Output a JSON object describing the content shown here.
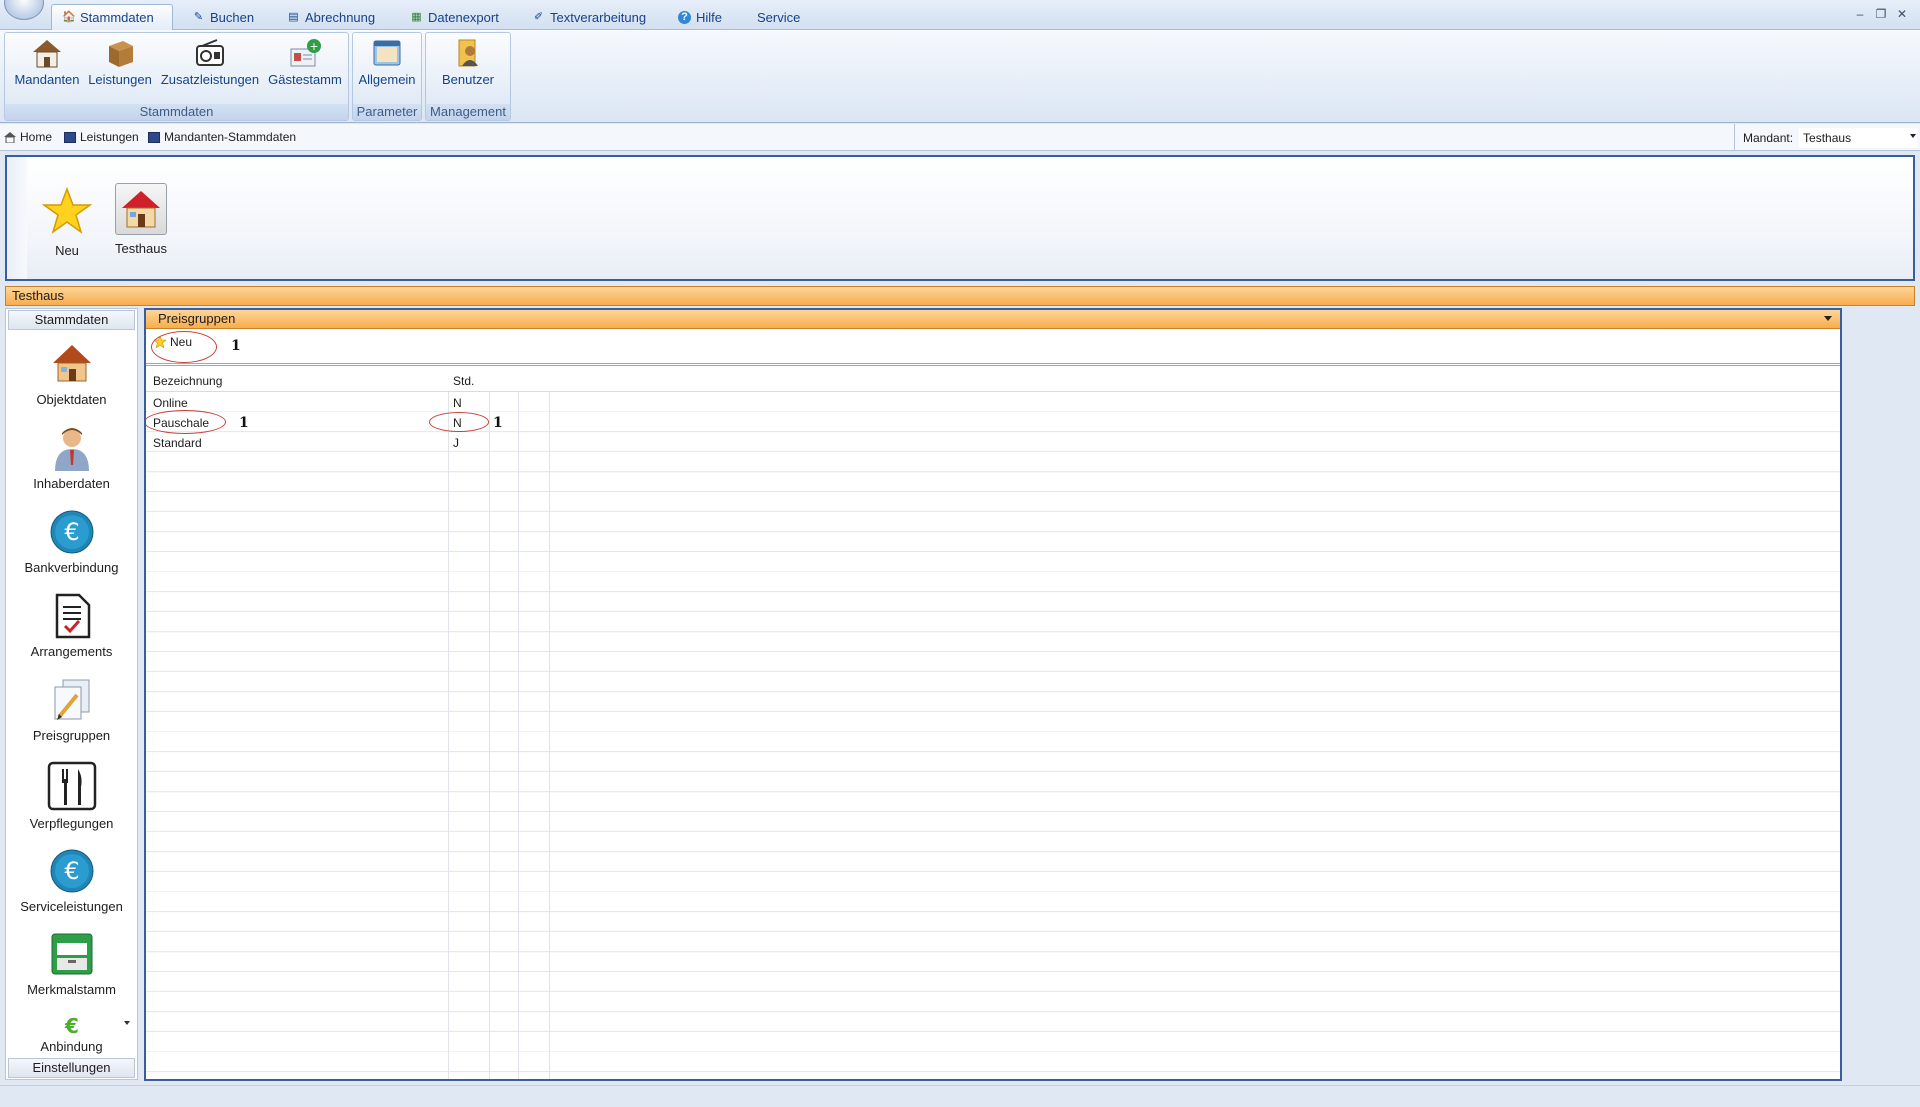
{
  "menu": {
    "tabs": [
      {
        "label": "Stammdaten",
        "icon": "stammdaten-icon",
        "active": true
      },
      {
        "label": "Buchen",
        "icon": "buchen-icon"
      },
      {
        "label": "Abrechnung",
        "icon": "abrechnung-icon"
      },
      {
        "label": "Datenexport",
        "icon": "datenexport-icon"
      },
      {
        "label": "Textverarbeitung",
        "icon": "textverarbeitung-icon"
      },
      {
        "label": "Hilfe",
        "icon": "help-icon"
      },
      {
        "label": "Service",
        "icon": ""
      }
    ],
    "window_controls": {
      "minimize": "–",
      "restore": "❐",
      "close": "✕"
    }
  },
  "ribbon": {
    "groups": [
      {
        "label": "Stammdaten",
        "buttons": [
          "Mandanten",
          "Leistungen",
          "Zusatzleistungen",
          "Gästestamm"
        ]
      },
      {
        "label": "Parameter",
        "buttons": [
          "Allgemein"
        ]
      },
      {
        "label": "Management",
        "buttons": [
          "Benutzer"
        ]
      }
    ]
  },
  "breadcrumb": {
    "items": [
      "Home",
      "Leistungen",
      "Mandanten-Stammdaten"
    ],
    "mandant_label": "Mandant:",
    "mandant_value": "Testhaus"
  },
  "toppanel": {
    "buttons": [
      {
        "label": "Neu",
        "icon": "star-icon"
      },
      {
        "label": "Testhaus",
        "icon": "house-icon"
      }
    ]
  },
  "house_bar": {
    "title": "Testhaus"
  },
  "sidenav": {
    "header_top": "Stammdaten",
    "items": [
      {
        "label": "Objektdaten",
        "icon": "house-icon"
      },
      {
        "label": "Inhaberdaten",
        "icon": "person-icon"
      },
      {
        "label": "Bankverbindung",
        "icon": "euro-icon"
      },
      {
        "label": "Arrangements",
        "icon": "document-check-icon"
      },
      {
        "label": "Preisgruppen",
        "icon": "documents-pencil-icon"
      },
      {
        "label": "Verpflegungen",
        "icon": "fork-knife-icon"
      },
      {
        "label": "Serviceleistungen",
        "icon": "euro-icon"
      },
      {
        "label": "Merkmalstamm",
        "icon": "cabinet-icon"
      },
      {
        "label": "Anbindung",
        "icon": "euro-green-icon"
      }
    ],
    "header_bottom": "Einstellungen"
  },
  "content": {
    "header": "Preisgruppen",
    "toolbar": {
      "new_label": "Neu"
    },
    "annotations": {
      "toolbar_mark": "1",
      "row_mark": "1",
      "std_mark": "1"
    },
    "table": {
      "columns": [
        "Bezeichnung",
        "Std."
      ],
      "rows": [
        {
          "bezeichnung": "Online",
          "std": "N"
        },
        {
          "bezeichnung": "Pauschale",
          "std": "N"
        },
        {
          "bezeichnung": "Standard",
          "std": "J"
        }
      ]
    }
  },
  "colors": {
    "accent_orange": "#f7ad4c",
    "frame_blue": "#3a5d9e",
    "ribbon_text": "#15428b",
    "annotation_red": "#c8403a"
  }
}
